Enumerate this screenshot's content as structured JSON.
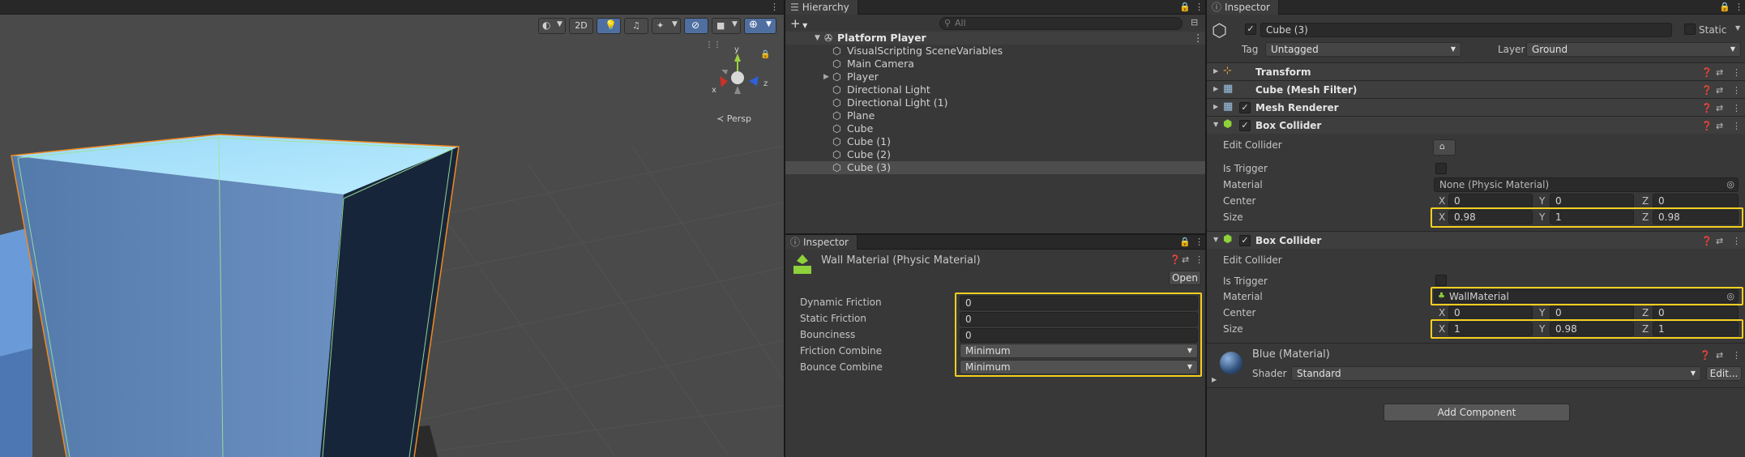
{
  "scene": {
    "toolbar": {
      "mode_2d": "2D"
    },
    "gizmo": {
      "y": "y",
      "x": "x",
      "z": "z",
      "persp": "Persp"
    }
  },
  "hierarchy": {
    "tab_label": "Hierarchy",
    "search_placeholder": "All",
    "root": "Platform Player",
    "items": [
      "VisualScripting SceneVariables",
      "Main Camera",
      "Player",
      "Directional Light",
      "Directional Light (1)",
      "Plane",
      "Cube",
      "Cube (1)",
      "Cube (2)",
      "Cube (3)"
    ]
  },
  "material_inspector": {
    "tab_label": "Inspector",
    "title": "Wall Material (Physic Material)",
    "open_button": "Open",
    "fields": [
      {
        "label": "Dynamic Friction",
        "value": "0"
      },
      {
        "label": "Static Friction",
        "value": "0"
      },
      {
        "label": "Bounciness",
        "value": "0"
      },
      {
        "label": "Friction Combine",
        "value": "Minimum"
      },
      {
        "label": "Bounce Combine",
        "value": "Minimum"
      }
    ]
  },
  "inspector": {
    "tab_label": "Inspector",
    "object_name": "Cube (3)",
    "static_label": "Static",
    "tag_label": "Tag",
    "tag_value": "Untagged",
    "layer_label": "Layer",
    "layer_value": "Ground",
    "components": {
      "transform": "Transform",
      "mesh_filter": "Cube (Mesh Filter)",
      "mesh_renderer": "Mesh Renderer",
      "box_collider_1": {
        "title": "Box Collider",
        "edit_collider": "Edit Collider",
        "is_trigger": "Is Trigger",
        "material_label": "Material",
        "material_value": "None (Physic Material)",
        "center_label": "Center",
        "center": {
          "x": "0",
          "y": "0",
          "z": "0"
        },
        "size_label": "Size",
        "size": {
          "x": "0.98",
          "y": "1",
          "z": "0.98"
        }
      },
      "box_collider_2": {
        "title": "Box Collider",
        "edit_collider": "Edit Collider",
        "is_trigger": "Is Trigger",
        "material_label": "Material",
        "material_value": "WallMaterial",
        "center_label": "Center",
        "center": {
          "x": "0",
          "y": "0",
          "z": "0"
        },
        "size_label": "Size",
        "size": {
          "x": "1",
          "y": "0.98",
          "z": "1"
        }
      },
      "material": {
        "title": "Blue (Material)",
        "shader_label": "Shader",
        "shader_value": "Standard",
        "edit_button": "Edit..."
      }
    },
    "axis_labels": {
      "x": "X",
      "y": "Y",
      "z": "Z"
    },
    "add_component": "Add Component"
  },
  "colors": {
    "highlight": "#f5cf1f",
    "cube_top": "#a6e0fb",
    "cube_front": "#5b81b3",
    "cube_side": "#19273a",
    "selection_outline": "#f08a1e"
  }
}
